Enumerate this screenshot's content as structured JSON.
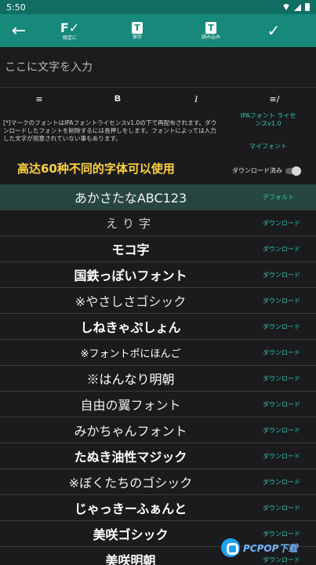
{
  "status_bar": {
    "time": "5:50"
  },
  "toolbar": {
    "tools": [
      {
        "glyph": "F✓",
        "label": "既定に"
      },
      {
        "glyph": "T",
        "label": "保存"
      },
      {
        "glyph": "T",
        "label": "読み込み"
      }
    ]
  },
  "input": {
    "placeholder": "ここに文字を入力"
  },
  "format": {
    "align": "≡",
    "bold": "B",
    "italic": "I",
    "other": "≡/"
  },
  "license": {
    "text": "[*]マークのフォントはIPAフォントライセンスv1.0の下で再配布されます。ダウンロードしたフォントを削除するには長押しをします。フォントによっては入力した文字が用意されていない事もあります。",
    "ipa_link": "IPAフォント ライセンスv1.0",
    "my_font_link": "マイフォント"
  },
  "promo": "高达60种不同的字体可以使用",
  "downloaded_toggle": {
    "label": "ダウンロード済み",
    "checked": false
  },
  "fonts": [
    {
      "name": "あかさたなABC123",
      "action": "デフォルト"
    },
    {
      "name": "えり字",
      "action": "ダウンロード"
    },
    {
      "name": "モコ字",
      "action": "ダウンロード"
    },
    {
      "name": "国鉄っぽいフォント",
      "action": "ダウンロード"
    },
    {
      "name": "※やさしさゴシック",
      "action": "ダウンロード"
    },
    {
      "name": "しねきゃぷしょん",
      "action": "ダウンロード"
    },
    {
      "name": "※フォントポにほんご",
      "action": "ダウンロード"
    },
    {
      "name": "※はんなり明朝",
      "action": "ダウンロード"
    },
    {
      "name": "自由の翼フォント",
      "action": "ダウンロード"
    },
    {
      "name": "みかちゃんフォント",
      "action": "ダウンロード"
    },
    {
      "name": "たぬき油性マジック",
      "action": "ダウンロード"
    },
    {
      "name": "※ぼくたちのゴシック",
      "action": "ダウンロード"
    },
    {
      "name": "じゃっきーふぁんと",
      "action": "ダウンロード"
    },
    {
      "name": "美咲ゴシック",
      "action": "ダウンロード"
    },
    {
      "name": "美咲明朝",
      "action": "ダウンロード"
    }
  ],
  "watermark": "PCPOP下载"
}
